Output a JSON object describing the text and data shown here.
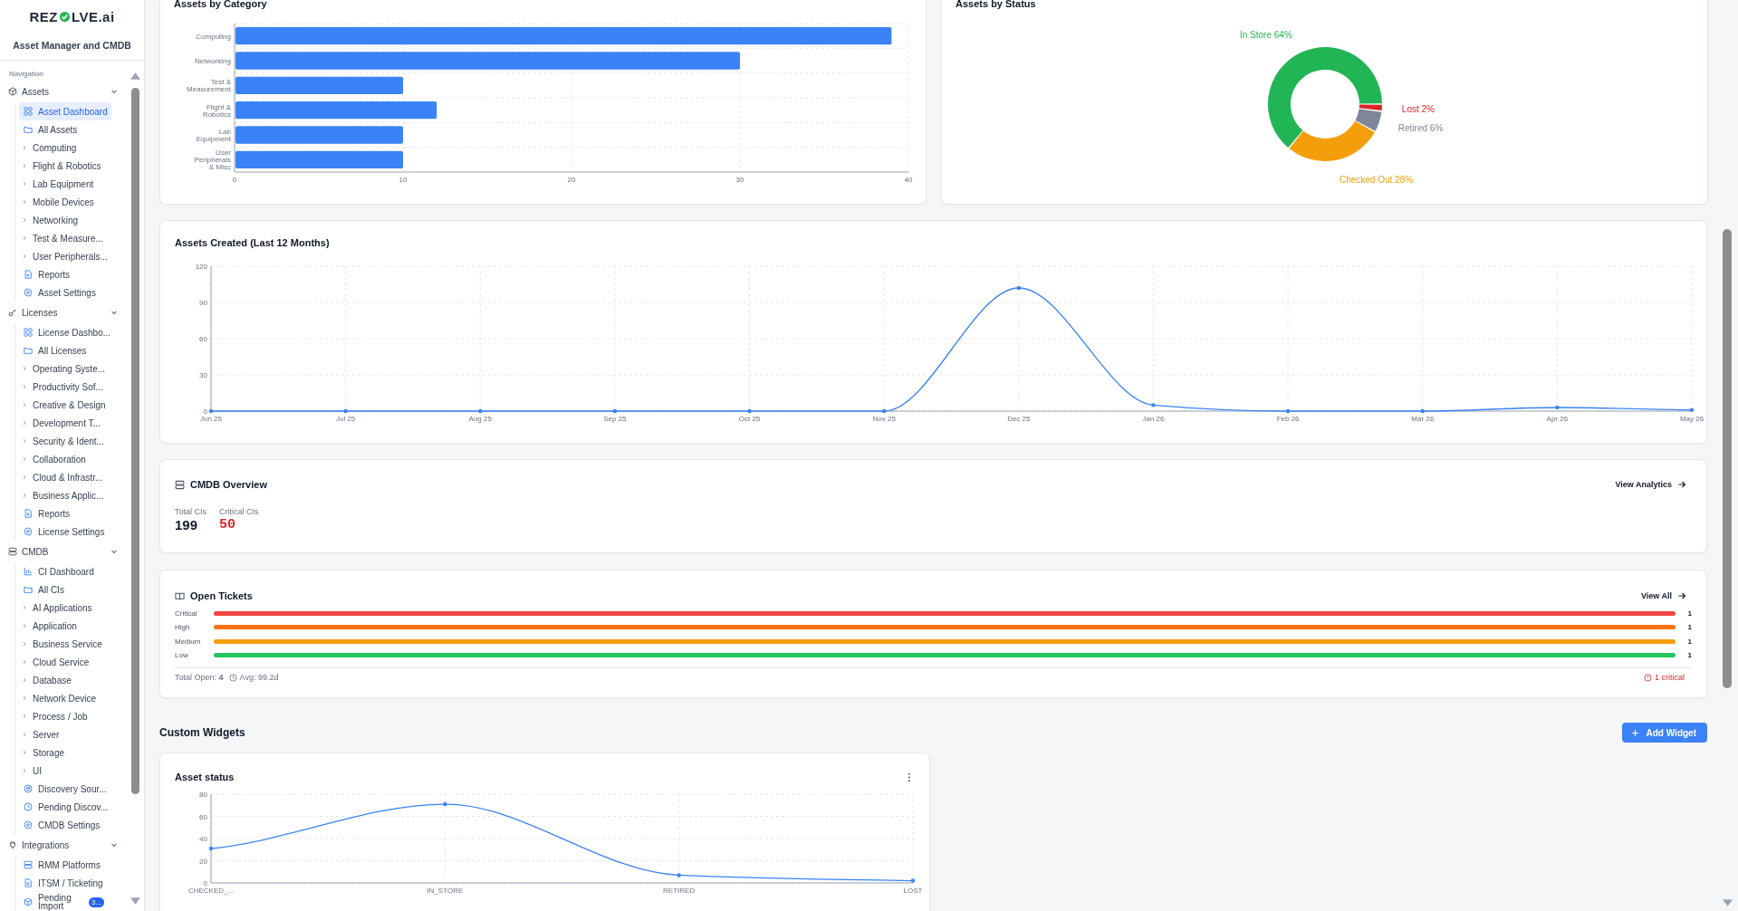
{
  "sidebar": {
    "logo_start": "REZ",
    "logo_end": "LVE.ai",
    "subtitle": "Asset Manager and CMDB",
    "nav_heading": "Navigation",
    "sections": [
      {
        "label": "Assets",
        "kind": "cube",
        "expanded": true,
        "items": [
          {
            "label": "Asset Dashboard",
            "kind": "dashboard",
            "selected": true
          },
          {
            "label": "All Assets",
            "kind": "folder",
            "selected": false
          },
          {
            "label": "Computing",
            "kind": "category",
            "selected": false
          },
          {
            "label": "Flight & Robotics",
            "kind": "category",
            "selected": false
          },
          {
            "label": "Lab Equipment",
            "kind": "category",
            "selected": false
          },
          {
            "label": "Mobile Devices",
            "kind": "category",
            "selected": false
          },
          {
            "label": "Networking",
            "kind": "category",
            "selected": false
          },
          {
            "label": "Test & Measure...",
            "kind": "category",
            "selected": false
          },
          {
            "label": "User Peripherals...",
            "kind": "category",
            "selected": false
          },
          {
            "label": "Reports",
            "kind": "report",
            "selected": false
          },
          {
            "label": "Asset Settings",
            "kind": "settings",
            "selected": false
          }
        ]
      },
      {
        "label": "Licenses",
        "kind": "key",
        "expanded": true,
        "items": [
          {
            "label": "License Dashbo...",
            "kind": "dashboard",
            "selected": false
          },
          {
            "label": "All Licenses",
            "kind": "folder",
            "selected": false
          },
          {
            "label": "Operating Syste...",
            "kind": "category",
            "selected": false
          },
          {
            "label": "Productivity Sof...",
            "kind": "category",
            "selected": false
          },
          {
            "label": "Creative & Design",
            "kind": "category",
            "selected": false
          },
          {
            "label": "Development T...",
            "kind": "category",
            "selected": false
          },
          {
            "label": "Security & Ident...",
            "kind": "category",
            "selected": false
          },
          {
            "label": "Collaboration",
            "kind": "category",
            "selected": false
          },
          {
            "label": "Cloud & Infrastr...",
            "kind": "category",
            "selected": false
          },
          {
            "label": "Business Applic...",
            "kind": "category",
            "selected": false
          },
          {
            "label": "Reports",
            "kind": "report",
            "selected": false
          },
          {
            "label": "License Settings",
            "kind": "settings",
            "selected": false
          }
        ]
      },
      {
        "label": "CMDB",
        "kind": "server",
        "expanded": true,
        "items": [
          {
            "label": "CI Dashboard",
            "kind": "chart",
            "selected": false
          },
          {
            "label": "All CIs",
            "kind": "folder",
            "selected": false
          },
          {
            "label": "AI Applications",
            "kind": "category",
            "selected": false
          },
          {
            "label": "Application",
            "kind": "category",
            "selected": false
          },
          {
            "label": "Business Service",
            "kind": "category",
            "selected": false
          },
          {
            "label": "Cloud Service",
            "kind": "category",
            "selected": false
          },
          {
            "label": "Database",
            "kind": "category",
            "selected": false
          },
          {
            "label": "Network Device",
            "kind": "category",
            "selected": false
          },
          {
            "label": "Process / Job",
            "kind": "category",
            "selected": false
          },
          {
            "label": "Server",
            "kind": "category",
            "selected": false
          },
          {
            "label": "Storage",
            "kind": "category",
            "selected": false
          },
          {
            "label": "UI",
            "kind": "category",
            "selected": false
          },
          {
            "label": "Discovery Sour...",
            "kind": "discovery",
            "selected": false
          },
          {
            "label": "Pending Discov...",
            "kind": "clock",
            "selected": false
          },
          {
            "label": "CMDB Settings",
            "kind": "settings",
            "selected": false
          }
        ]
      },
      {
        "label": "Integrations",
        "kind": "plug",
        "expanded": true,
        "items": [
          {
            "label": "RMM Platforms",
            "kind": "server",
            "selected": false
          },
          {
            "label": "ITSM / Ticketing",
            "kind": "report",
            "selected": false
          },
          {
            "label": "Pending Import",
            "kind": "package",
            "selected": false,
            "badge": "3..."
          }
        ]
      }
    ]
  },
  "category_chart": {
    "title": "Assets by Category",
    "chart_data": {
      "type": "bar",
      "orientation": "horizontal",
      "categories": [
        "Computing",
        "Networking",
        "Test & Measurement",
        "Flight & Robotics",
        "Lab Equipment",
        "User Peripherals & Misc"
      ],
      "series": [
        {
          "color": "#3b82f6",
          "values": [
            39,
            30,
            10,
            12,
            10,
            10
          ]
        }
      ],
      "xlim": [
        0,
        40
      ],
      "xticks": [
        0,
        10,
        20,
        30,
        40
      ],
      "grid": true
    }
  },
  "status_chart": {
    "title": "Assets by Status",
    "chart_data": {
      "type": "donut",
      "categories": [
        "In Store",
        "Checked Out",
        "Retired",
        "Lost"
      ],
      "values": [
        64,
        28,
        6,
        2
      ],
      "colors": [
        "#22b555",
        "#f59e0b",
        "#7d8799",
        "#dc2626"
      ],
      "value_labels": [
        "64%",
        "28%",
        "6%",
        "2%"
      ]
    }
  },
  "created_chart": {
    "title": "Assets Created (Last 12 Months)",
    "chart_data": {
      "type": "line",
      "categories": [
        "Jun 25",
        "Jul 25",
        "Aug 25",
        "Sep 25",
        "Oct 25",
        "Nov 25",
        "Dec 25",
        "Jan 26",
        "Feb 26",
        "Mar 26",
        "Apr 26",
        "May 26"
      ],
      "series": [
        {
          "color": "#3b82f6",
          "values": [
            0,
            0,
            0,
            0,
            0,
            0,
            102,
            5,
            0,
            0,
            3,
            1
          ]
        }
      ],
      "ylim": [
        0,
        120
      ],
      "yticks": [
        0,
        30,
        60,
        90,
        120
      ],
      "grid": true
    }
  },
  "cmdb_overview": {
    "title": "CMDB Overview",
    "link": "View Analytics",
    "stats": [
      {
        "label": "Total CIs",
        "value": "199",
        "kind": "total"
      },
      {
        "label": "Critical CIs",
        "value": "50",
        "kind": "critical"
      }
    ]
  },
  "open_tickets": {
    "title": "Open Tickets",
    "link": "View All",
    "rows": [
      {
        "label": "Critical",
        "level": 1,
        "count": "1",
        "color": "#ef4444"
      },
      {
        "label": "High",
        "level": 1,
        "count": "1",
        "color": "#f97316"
      },
      {
        "label": "Medium",
        "level": 1,
        "count": "1",
        "color": "#f59e0b"
      },
      {
        "label": "Low",
        "level": 1,
        "count": "1",
        "color": "#22c55e"
      }
    ],
    "total": "Total Open: **4**",
    "average": "Avg: 99.2d",
    "critical_note": "1 critical"
  },
  "custom_widgets": {
    "title": "Custom Widgets",
    "add_button": "Add Widget",
    "widgets": [
      {
        "title": "Asset status",
        "chart_data": {
          "type": "line",
          "categories": [
            "CHECKED_...",
            "IN_STORE",
            "RETIRED",
            "LOST"
          ],
          "series": [
            {
              "color": "#3b82f6",
              "values": [
                31,
                71,
                7,
                2
              ]
            }
          ],
          "ylim": [
            0,
            80
          ],
          "yticks": [
            0,
            20,
            40,
            60,
            80
          ],
          "grid": true
        }
      }
    ]
  }
}
